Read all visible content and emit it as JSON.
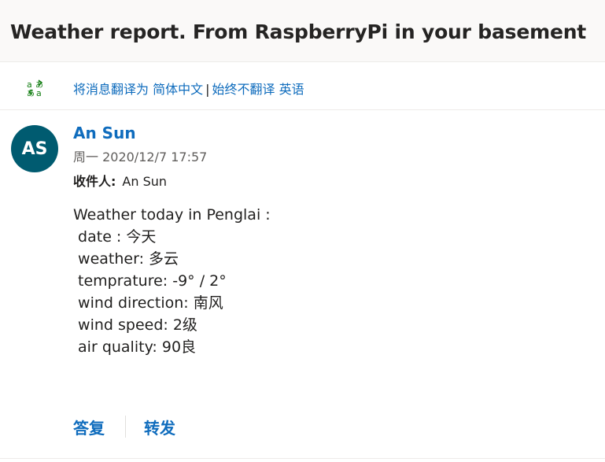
{
  "email": {
    "subject": "Weather report. From RaspberryPi in your basement",
    "translate": {
      "translate_link": "将消息翻译为 简体中文",
      "separator": "|",
      "never_link": "始终不翻译 英语"
    },
    "avatar_initials": "AS",
    "sender": "An Sun",
    "datetime": "周一 2020/12/7 17:57",
    "recipient_label": "收件人:",
    "recipient": "An Sun",
    "body": "Weather today in Penglai :\n date : 今天\n weather: 多云\n temprature: -9° / 2°\n wind direction: 南风\n wind speed: 2级\n air quality: 90良",
    "actions": {
      "reply": "答复",
      "forward": "转发"
    }
  },
  "colors": {
    "accent": "#0f6cbd",
    "avatar_bg": "#005b70",
    "header_bg": "#faf9f8",
    "icon_green": "#107c10"
  },
  "icons": {
    "translate": "translate-icon"
  }
}
